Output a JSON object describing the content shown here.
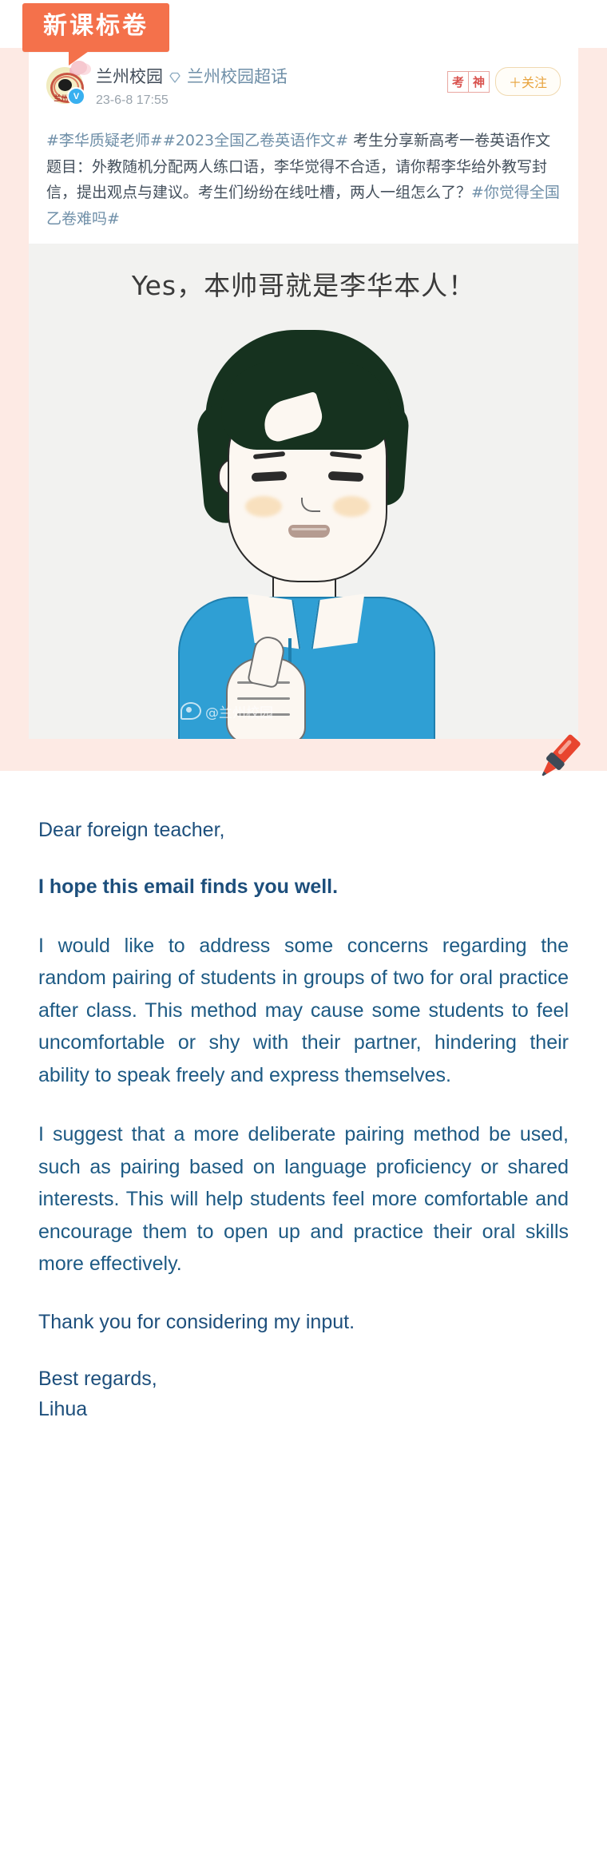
{
  "badge": {
    "label": "新课标卷"
  },
  "weibo": {
    "avatar": {
      "alt": "兰州校园头像",
      "inner_label": "兰州校"
    },
    "verified_mark": "V",
    "username": "兰州校园",
    "supertopic": "兰州校园超话",
    "supertopic_icon": "diamond-icon",
    "timestamp": "23-6-8 17:55",
    "stamp_chars": [
      "考",
      "神"
    ],
    "follow_button": "＋关注",
    "post_text": {
      "hashtag_1": "#李华质疑老师#",
      "hashtag_2": "#2023全国乙卷英语作文#",
      "body": " 考生分享新高考一卷英语作文题目：外教随机分配两人练口语，李华觉得不合适，请你帮李华给外教写封信，提出观点与建议。考生们纷纷在线吐槽，两人一组怎么了？",
      "hashtag_3": "#你觉得全国乙卷难吗#"
    },
    "image": {
      "caption": "Yes，本帅哥就是李华本人！",
      "watermark": "@兰州校园",
      "alt": "卡通男孩比大拇指"
    }
  },
  "letter": {
    "salutation": "Dear foreign teacher,",
    "opening": "I hope this email finds you well.",
    "paragraph_1": "I would like to address some concerns regarding the random pairing of students in groups of two for oral practice after class. This method may cause some students to feel uncomfortable or shy with their partner, hindering their ability to speak freely and express themselves.",
    "paragraph_2": "I suggest that a more deliberate pairing method be used, such as pairing based on language proficiency or shared interests. This will help students feel more comfortable and encourage them to open up and practice their oral skills more effectively.",
    "closing": "Thank you for considering my input.",
    "signoff": "Best regards,",
    "signature": "Lihua"
  },
  "colors": {
    "badge_orange": "#f4714b",
    "panel_pink": "#fdeae4",
    "follow_orange": "#e8a33d",
    "link_blue": "#6f8fa8",
    "letter_navy": "#1d4f7c",
    "letter_blue": "#1d5a84",
    "shirt_blue": "#2f9fd4",
    "pen_red": "#e8452f"
  }
}
